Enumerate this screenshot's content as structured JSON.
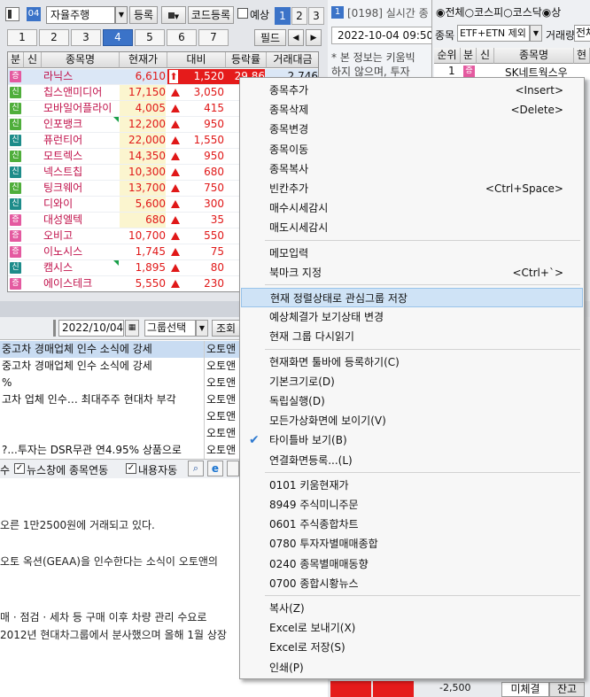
{
  "toolbar": {
    "code": "04",
    "group_select": "자율주행",
    "register_btn": "등록",
    "code_register_btn": "코드등록",
    "forecast_label": "예상",
    "page_tabs": [
      "1",
      "2",
      "3"
    ],
    "field_btn": "필드"
  },
  "group_tabs": [
    "1",
    "2",
    "3",
    "4",
    "5",
    "6",
    "7"
  ],
  "group_tab_selected": "4",
  "grid": {
    "headers": [
      "분",
      "신",
      "종목명",
      "현재가",
      "대비",
      "등락률",
      "거래대금"
    ],
    "rows": [
      {
        "badge": "증",
        "name": "라닉스",
        "price": "6,610",
        "change": "1,520",
        "rate": "29.86",
        "volume": "2,746",
        "badge_color": "pink",
        "arrow": "up-limit"
      },
      {
        "badge": "신",
        "name": "칩스앤미디어",
        "price": "17,150",
        "change": "3,050",
        "rate": "2",
        "volume": "",
        "badge_color": "green",
        "arrow": "up"
      },
      {
        "badge": "신",
        "name": "모바일어플라이",
        "price": "4,005",
        "change": "415",
        "rate": "1",
        "volume": "",
        "badge_color": "green",
        "arrow": "up"
      },
      {
        "badge": "신",
        "name": "인포뱅크",
        "price": "12,200",
        "change": "950",
        "rate": "",
        "volume": "",
        "badge_color": "green",
        "arrow": "up"
      },
      {
        "badge": "신",
        "name": "퓨런티어",
        "price": "22,000",
        "change": "1,550",
        "rate": "",
        "volume": "",
        "badge_color": "teal",
        "arrow": "up"
      },
      {
        "badge": "신",
        "name": "모트렉스",
        "price": "14,350",
        "change": "950",
        "rate": "",
        "volume": "",
        "badge_color": "green",
        "arrow": "up"
      },
      {
        "badge": "신",
        "name": "넥스트칩",
        "price": "10,300",
        "change": "680",
        "rate": "",
        "volume": "",
        "badge_color": "teal",
        "arrow": "up"
      },
      {
        "badge": "신",
        "name": "팅크웨어",
        "price": "13,700",
        "change": "750",
        "rate": "",
        "volume": "",
        "badge_color": "green",
        "arrow": "up"
      },
      {
        "badge": "신",
        "name": "디와이",
        "price": "5,600",
        "change": "300",
        "rate": "",
        "volume": "",
        "badge_color": "teal",
        "arrow": "up"
      },
      {
        "badge": "증",
        "name": "대성엘텍",
        "price": "680",
        "change": "35",
        "rate": "",
        "volume": "",
        "badge_color": "pink",
        "arrow": "up"
      },
      {
        "badge": "증",
        "name": "오비고",
        "price": "10,700",
        "change": "550",
        "rate": "",
        "volume": "",
        "badge_color": "pink",
        "arrow": "up"
      },
      {
        "badge": "증",
        "name": "이노시스",
        "price": "1,745",
        "change": "75",
        "rate": "",
        "volume": "",
        "badge_color": "pink",
        "arrow": "up"
      },
      {
        "badge": "신",
        "name": "캠시스",
        "price": "1,895",
        "change": "80",
        "rate": "",
        "volume": "",
        "badge_color": "teal",
        "arrow": "up"
      },
      {
        "badge": "증",
        "name": "에이스테크",
        "price": "5,550",
        "change": "230",
        "rate": "",
        "volume": "",
        "badge_color": "pink",
        "arrow": "up"
      }
    ]
  },
  "news": {
    "date": "2022/10/04",
    "group_select": "그룹선택",
    "query_btn": "조회",
    "rows": [
      {
        "title": "중고차 경매업체 인수 소식에 강세",
        "source": "오토앤"
      },
      {
        "title": "중고차 경매업체 인수 소식에 강세",
        "source": "오토앤"
      },
      {
        "title": "%",
        "source": "오토앤"
      },
      {
        "title": "고차 업체 인수… 최대주주 현대차 부각",
        "source": "오토앤"
      },
      {
        "title": "",
        "source": "오토앤"
      },
      {
        "title": "",
        "source": "오토앤"
      },
      {
        "title": "?...투자는 DSR무관 연4.95% 상품으로",
        "source": "오토앤"
      }
    ],
    "options": {
      "partial": "수",
      "news_link": "뉴스창에 종목연동",
      "content_link": "내용자동"
    },
    "body": [
      "오른 1만2500원에 거래되고 있다.",
      "오토 옥션(GEAA)을 인수한다는 소식이 오토앤의",
      "매 · 점검 · 세차 등 구매 이후 차량 관리 수요로",
      "2012년 현대차그룹에서 분사했으며 올해 1월 상장"
    ]
  },
  "context_menu": {
    "groups": [
      [
        {
          "label": "종목추가",
          "shortcut": "<Insert>"
        },
        {
          "label": "종목삭제",
          "shortcut": "<Delete>"
        },
        {
          "label": "종목변경",
          "shortcut": ""
        },
        {
          "label": "종목이동",
          "shortcut": ""
        },
        {
          "label": "종목복사",
          "shortcut": ""
        },
        {
          "label": "빈칸추가",
          "shortcut": "<Ctrl+Space>"
        },
        {
          "label": "매수시세감시",
          "shortcut": ""
        },
        {
          "label": "매도시세감시",
          "shortcut": ""
        }
      ],
      [
        {
          "label": "메모입력",
          "shortcut": ""
        },
        {
          "label": "북마크 지정",
          "shortcut": "<Ctrl+`>"
        }
      ],
      [
        {
          "label": "현재 정렬상태로 관심그룹 저장",
          "shortcut": "",
          "highlighted": true
        },
        {
          "label": "예상체결가 보기상태 변경",
          "shortcut": ""
        },
        {
          "label": "현재 그룹 다시읽기",
          "shortcut": ""
        }
      ],
      [
        {
          "label": "현재화면 툴바에 등록하기(C)",
          "shortcut": ""
        },
        {
          "label": "기본크기로(D)",
          "shortcut": ""
        },
        {
          "label": "독립실행(D)",
          "shortcut": ""
        },
        {
          "label": "모든가상화면에 보이기(V)",
          "shortcut": ""
        },
        {
          "label": "타이틀바 보기(B)",
          "shortcut": "",
          "checked": true
        },
        {
          "label": "연결화면등록...(L)",
          "shortcut": ""
        }
      ],
      [
        {
          "label": "0101 키움현재가",
          "shortcut": ""
        },
        {
          "label": "8949 주식미니주문",
          "shortcut": ""
        },
        {
          "label": "0601 주식종합차트",
          "shortcut": ""
        },
        {
          "label": "0780 투자자별매매종합",
          "shortcut": ""
        },
        {
          "label": "0240 종목별매매동향",
          "shortcut": ""
        },
        {
          "label": "0700 종합시황뉴스",
          "shortcut": ""
        }
      ],
      [
        {
          "label": "복사(Z)",
          "shortcut": ""
        },
        {
          "label": "Excel로 보내기(X)",
          "shortcut": ""
        },
        {
          "label": "Excel로 저장(S)",
          "shortcut": ""
        },
        {
          "label": "인쇄(P)",
          "shortcut": ""
        }
      ]
    ]
  },
  "right_panel": {
    "title_num": "1",
    "title": "[0198] 실시간 종",
    "datetime": "2022-10-04 09:50",
    "notice_line1": "* 본 정보는 키움빅",
    "notice_line2": "하지 않으며, 투자",
    "market_radios": [
      "전체",
      "코스피",
      "코스닥",
      "상"
    ],
    "item_label": "종목",
    "item_select": "ETF+ETN 제외",
    "volume_label": "거래량",
    "volume_select": "전체",
    "headers": [
      "순위",
      "분",
      "신",
      "종목명",
      "현"
    ],
    "first_row": {
      "rank": "1",
      "badge": "증",
      "name": "SK네트웍스우"
    },
    "price_tick": "-2,500",
    "bottom_tabs": [
      "미체결",
      "잔고"
    ]
  }
}
